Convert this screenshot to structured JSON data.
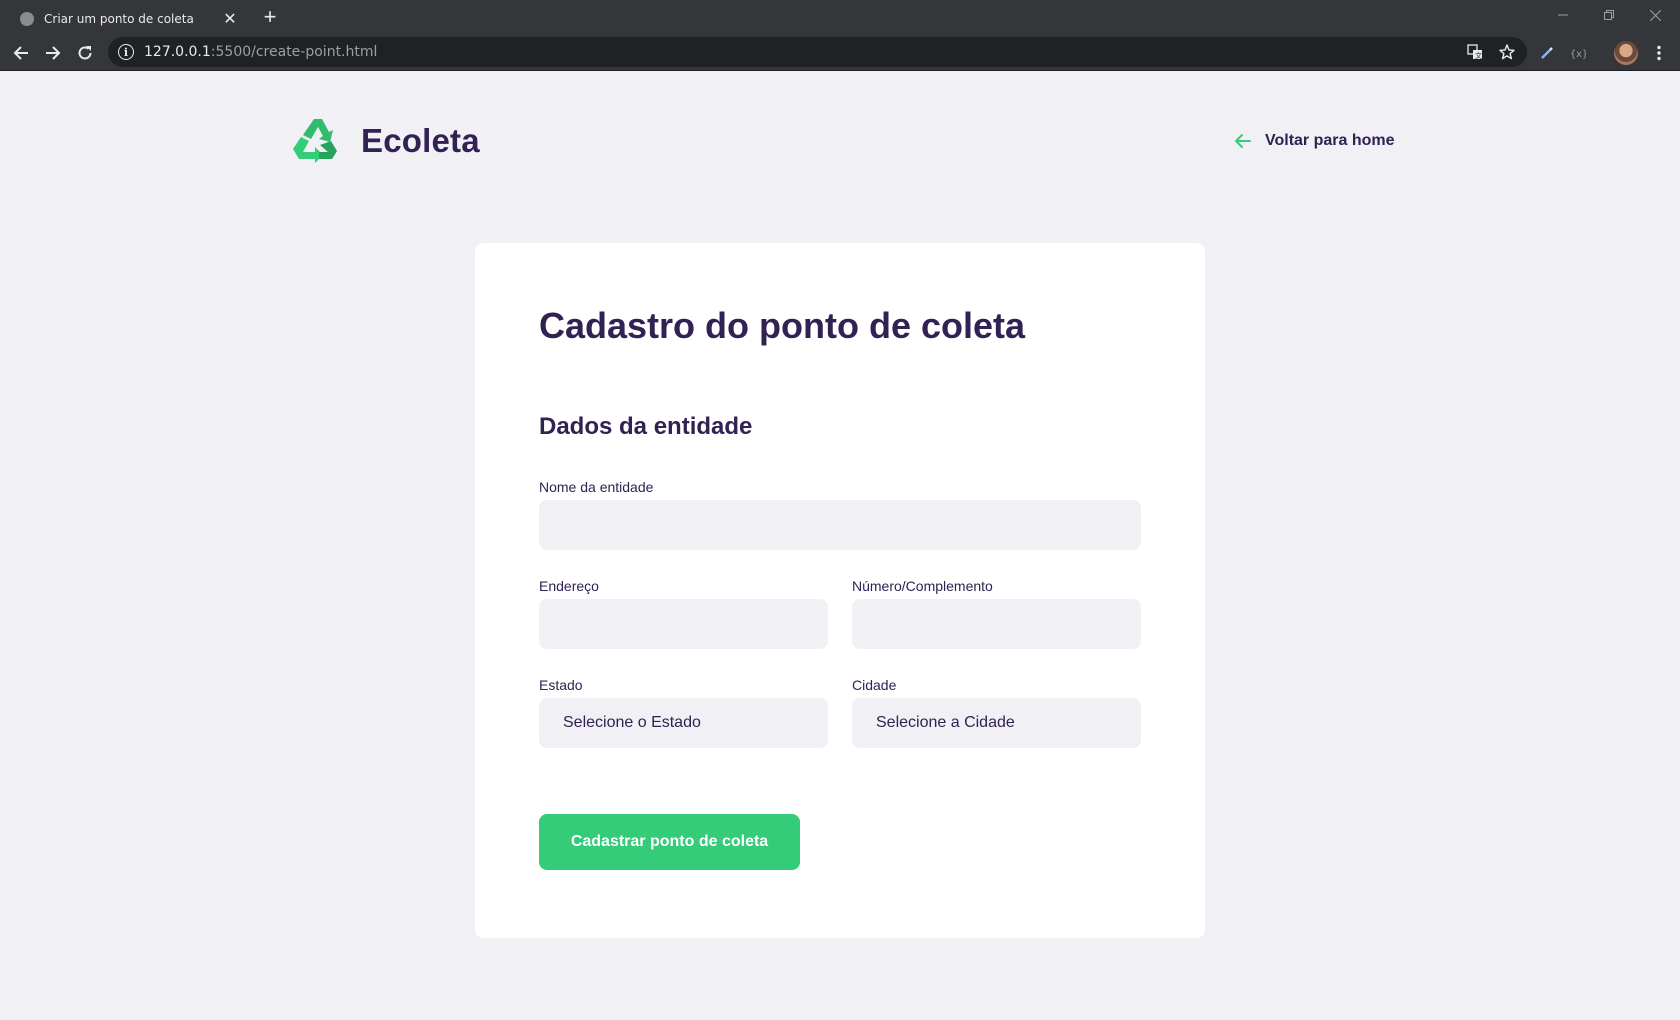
{
  "browser": {
    "tab": {
      "title": "Criar um ponto de coleta"
    },
    "address": {
      "host": "127.0.0.1",
      "path": ":5500/create-point.html"
    }
  },
  "header": {
    "logo_text": "Ecoleta",
    "back_link": "Voltar para home"
  },
  "form": {
    "title": "Cadastro do ponto de coleta",
    "section_title": "Dados da entidade",
    "fields": {
      "name_label": "Nome da entidade",
      "address_label": "Endereço",
      "number_label": "Número/Complemento",
      "state_label": "Estado",
      "state_value": "Selecione o Estado",
      "city_label": "Cidade",
      "city_value": "Selecione a Cidade"
    },
    "submit_label": "Cadastrar ponto de coleta"
  },
  "colors": {
    "primary_text": "#322153",
    "accent_green": "#34cb79",
    "page_bg": "#f0f0f5"
  }
}
